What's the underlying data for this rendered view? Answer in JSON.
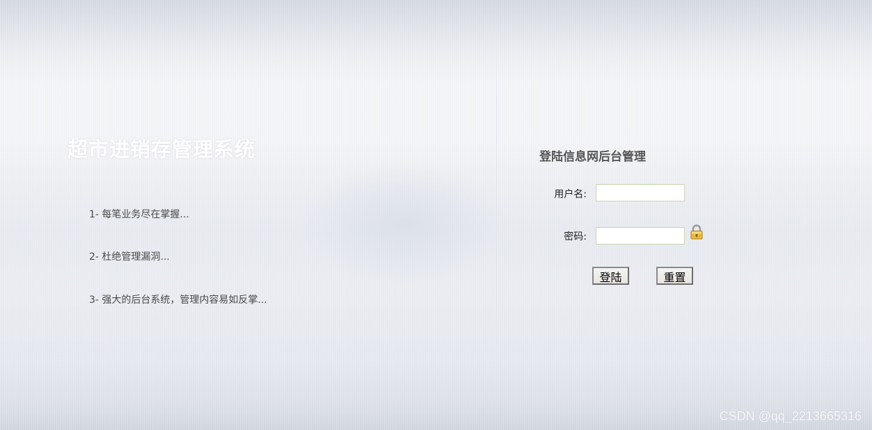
{
  "system_title": "超市进销存管理系统",
  "features": [
    "1- 每笔业务尽在掌握...",
    "2- 杜绝管理漏洞...",
    "3- 强大的后台系统，管理内容易如反掌..."
  ],
  "login": {
    "title": "登陆信息网后台管理",
    "username_label": "用户名:",
    "username_value": "",
    "password_label": "密码:",
    "password_value": "",
    "lock_icon": "lock-icon",
    "login_button": "登陆",
    "reset_button": "重置"
  },
  "watermark": "CSDN @qq_2213665316",
  "colors": {
    "input_border": "#c9d4ae",
    "title_text": "#555555",
    "lock_gold": "#e8b93c"
  }
}
